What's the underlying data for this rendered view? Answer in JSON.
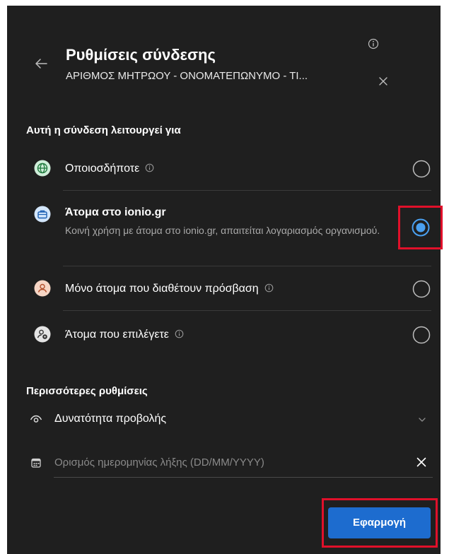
{
  "header": {
    "title": "Ρυθμίσεις σύνδεσης",
    "subtitle": "ΑΡΙΘΜΟΣ ΜΗΤΡΩΟΥ - ΟΝΟΜΑΤΕΠΩΝΥΜΟ - ΤΙ..."
  },
  "access_section": {
    "heading": "Αυτή η σύνδεση λειτουργεί για",
    "options": [
      {
        "label": "Οποιοσδήποτε",
        "icon": "globe-icon",
        "has_info": true,
        "selected": false
      },
      {
        "label": "Άτομα στο ionio.gr",
        "description": "Κοινή χρήση με άτομα στο ionio.gr, απαιτείται λογαριασμός οργανισμού.",
        "icon": "briefcase-icon",
        "has_info": false,
        "selected": true
      },
      {
        "label": "Μόνο άτομα που διαθέτουν πρόσβαση",
        "icon": "person-icon",
        "has_info": true,
        "selected": false
      },
      {
        "label": "Άτομα που επιλέγετε",
        "icon": "people-gear-icon",
        "has_info": true,
        "selected": false
      }
    ]
  },
  "more_settings": {
    "heading": "Περισσότερες ρυθμίσεις",
    "view_permission": "Δυνατότητα προβολής",
    "expiry_placeholder": "Ορισμός ημερομηνίας λήξης (DD/MM/YYYY)"
  },
  "footer": {
    "apply_label": "Εφαρμογή"
  },
  "colors": {
    "panel_bg": "#1f1f1f",
    "accent": "#1d6ccf",
    "selected_radio": "#4aa0f0",
    "highlight_box": "#e0102a"
  }
}
